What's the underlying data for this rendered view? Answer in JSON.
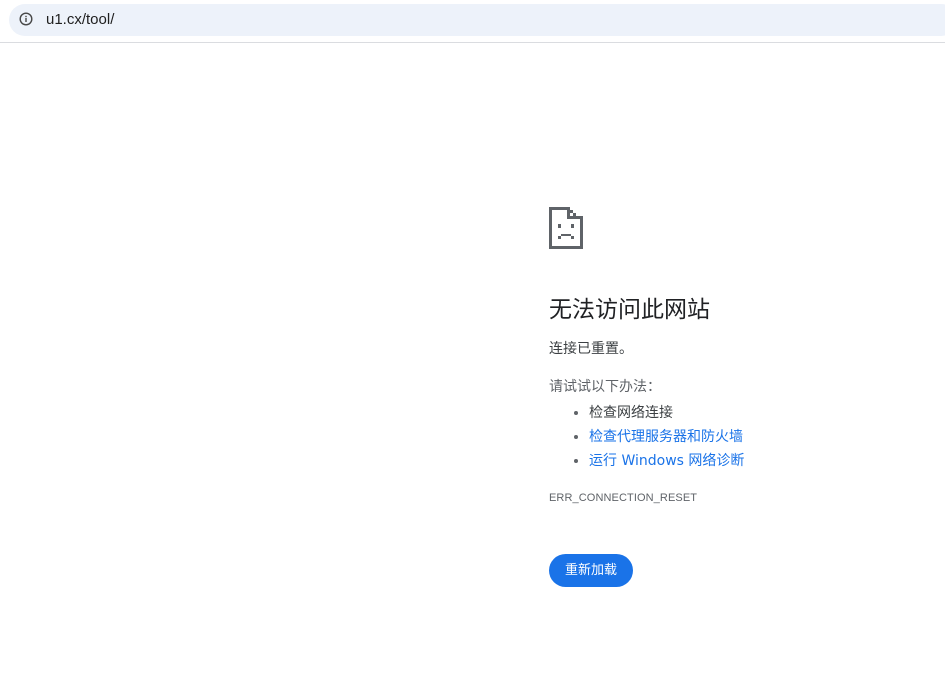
{
  "browser": {
    "url": "u1.cx/tool/",
    "site_info_icon": "info-circle-icon"
  },
  "error_page": {
    "icon": "sad-page-icon",
    "title": "无法访问此网站",
    "subtitle": "连接已重置。",
    "suggestions_intro": "请试试以下办法：",
    "suggestions": [
      {
        "text": "检查网络连接",
        "is_link": false
      },
      {
        "text": "检查代理服务器和防火墙",
        "is_link": true
      },
      {
        "text": "运行 Windows 网络诊断",
        "is_link": true
      }
    ],
    "error_code": "ERR_CONNECTION_RESET",
    "reload_label": "重新加载"
  },
  "colors": {
    "accent": "#1a73e8",
    "omnibox_bg": "#edf2fa",
    "text": "#202124",
    "secondary_text": "#5f6368"
  }
}
